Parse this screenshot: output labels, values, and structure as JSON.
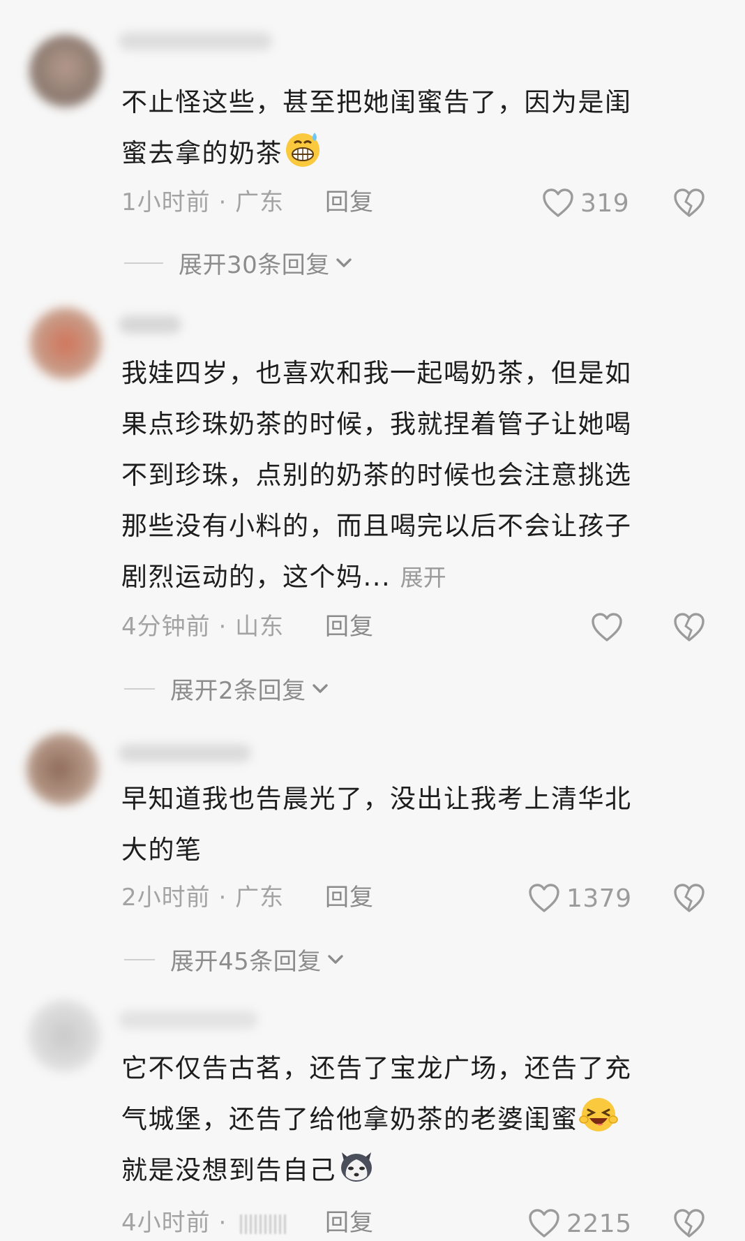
{
  "comments": [
    {
      "text": "不止怪这些，甚至把她闺蜜告了，因为是闺\n蜜去拿的奶茶",
      "text_emoji": "grimacing-sweat-emoji",
      "time": "1小时前",
      "location": "广东",
      "reply_label": "回复",
      "like_count": "319",
      "expand_label": "展开30条回复"
    },
    {
      "text": "我娃四岁，也喜欢和我一起喝奶茶，但是如\n果点珍珠奶茶的时候，我就捏着管子让她喝\n不到珍珠，点别的奶茶的时候也会注意挑选\n那些没有小料的，而且喝完以后不会让孩子\n剧烈运动的，这个妈...",
      "more_label": "展开",
      "time": "4分钟前",
      "location": "山东",
      "reply_label": "回复",
      "like_count": "",
      "expand_label": "展开2条回复"
    },
    {
      "text": "早知道我也告晨光了，没出让我考上清华北\n大的笔",
      "time": "2小时前",
      "location": "广东",
      "reply_label": "回复",
      "like_count": "1379",
      "expand_label": "展开45条回复"
    },
    {
      "text_line1": "它不仅告古茗，还告了宝龙广场，还告了充",
      "text_line2": "气城堡，还告了给他拿奶茶的老婆闺蜜",
      "text_line3": "就是没想到告自己",
      "line2_emoji": "laughing-wink-emoji",
      "line3_emoji": "husky-dog-emoji",
      "time": "4小时前",
      "location": "",
      "reply_label": "回复",
      "like_count": "2215"
    }
  ],
  "separator": "·",
  "colors": {
    "background": "#f7f7f7",
    "text": "#1d1d1d",
    "meta": "#a3a3a3",
    "icon": "#9b9b9b"
  }
}
